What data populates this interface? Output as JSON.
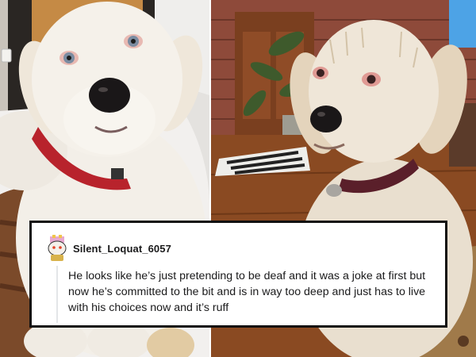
{
  "comment": {
    "username": "Silent_Loquat_6057",
    "text": "He looks like he’s just pretending to be deaf and it was a joke at first but now he’s committed to the bit and is in way too deep and just has to live with his choices now and it’s ruff"
  },
  "colors": {
    "card_background": "#ffffff",
    "card_border": "#111111",
    "text": "#1a1a1b",
    "dog_fur": "#f1ece4",
    "collar_left": "#b8232c",
    "collar_right": "#5a1f2a",
    "floor_wood": "#8a4a22",
    "brick_wall": "#8e4a3a"
  },
  "icons": {
    "avatar": "snoo-avatar-icon"
  }
}
